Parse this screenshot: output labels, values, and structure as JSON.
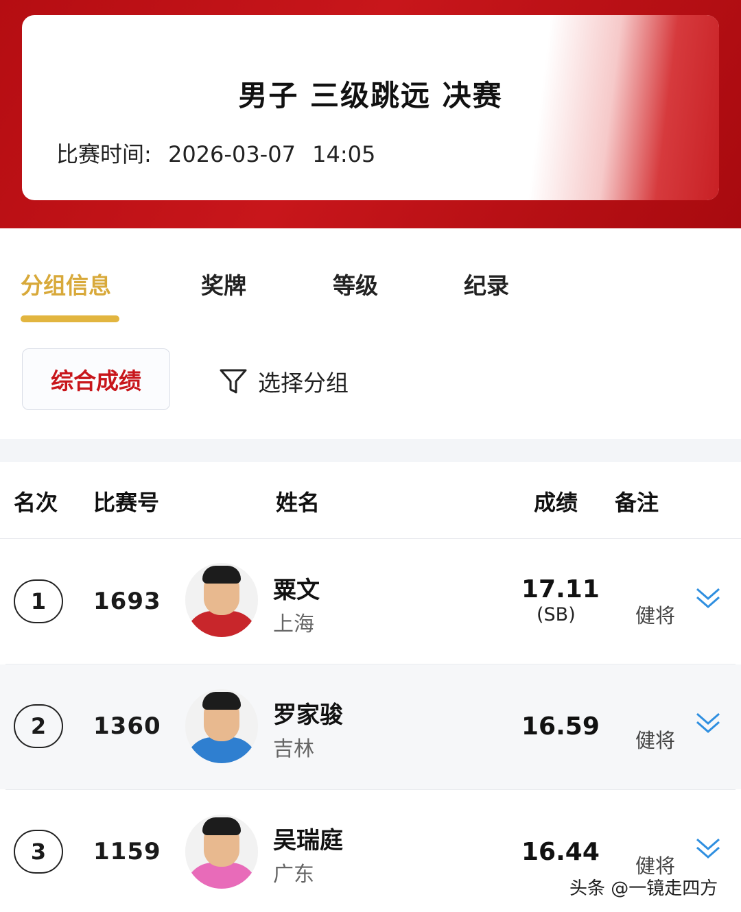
{
  "header": {
    "title": "男子 三级跳远 决赛",
    "time_label": "比赛时间:",
    "date": "2026-03-07",
    "time": "14:05"
  },
  "tabs": [
    {
      "label": "分组信息",
      "active": true
    },
    {
      "label": "奖牌",
      "active": false
    },
    {
      "label": "等级",
      "active": false
    },
    {
      "label": "纪录",
      "active": false
    }
  ],
  "filters": {
    "combined_label": "综合成绩",
    "select_group_label": "选择分组"
  },
  "table": {
    "columns": [
      "名次",
      "比赛号",
      "姓名",
      "成绩",
      "备注"
    ],
    "rows": [
      {
        "rank": "1",
        "bib": "1693",
        "name": "粟文",
        "team": "上海",
        "score": "17.11",
        "score_note": "(SB)",
        "remark": "健将",
        "jersey_color": "#c8262b"
      },
      {
        "rank": "2",
        "bib": "1360",
        "name": "罗家骏",
        "team": "吉林",
        "score": "16.59",
        "score_note": "",
        "remark": "健将",
        "jersey_color": "#2f7fd0"
      },
      {
        "rank": "3",
        "bib": "1159",
        "name": "吴瑞庭",
        "team": "广东",
        "score": "16.44",
        "score_note": "",
        "remark": "健将",
        "jersey_color": "#e86bb9"
      }
    ]
  },
  "watermark": "头条 @一镜走四方",
  "colors": {
    "brand_red": "#c8161b",
    "tab_active": "#d8a93a",
    "chevron": "#2f8fe0"
  }
}
